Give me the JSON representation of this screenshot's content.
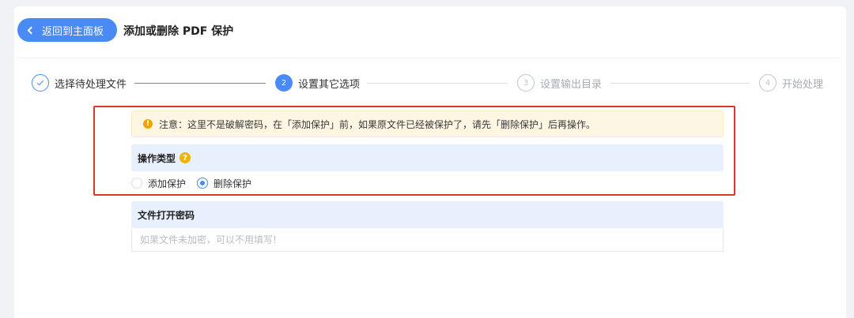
{
  "header": {
    "back_label": "返回到主面板",
    "title": "添加或删除 PDF 保护"
  },
  "steps": [
    {
      "number": "1",
      "label": "选择待处理文件",
      "state": "done"
    },
    {
      "number": "2",
      "label": "设置其它选项",
      "state": "active"
    },
    {
      "number": "3",
      "label": "设置输出目录",
      "state": "todo"
    },
    {
      "number": "4",
      "label": "开始处理",
      "state": "todo"
    }
  ],
  "notice": {
    "icon": "!",
    "text": "注意：这里不是破解密码，在「添加保护」前，如果原文件已经被保护了，请先「删除保护」后再操作。"
  },
  "operation": {
    "heading": "操作类型",
    "help_icon": "?",
    "options": [
      {
        "label": "添加保护",
        "checked": false
      },
      {
        "label": "删除保护",
        "checked": true
      }
    ]
  },
  "password": {
    "heading": "文件打开密码",
    "value": "",
    "placeholder": "如果文件未加密，可以不用填写!"
  },
  "colors": {
    "accent": "#4a8af4",
    "highlight": "#e0342b",
    "warning": "#f0a400"
  }
}
